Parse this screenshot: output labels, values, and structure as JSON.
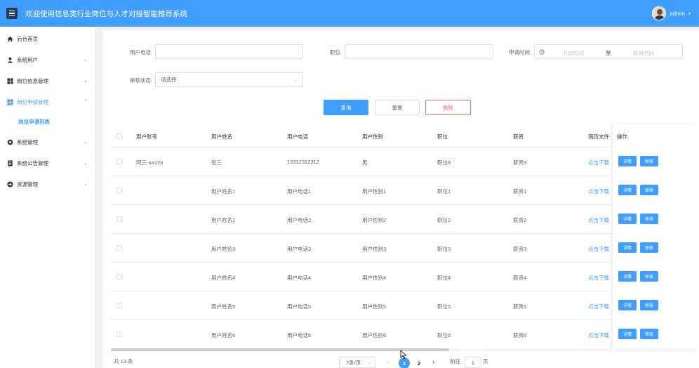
{
  "header": {
    "title": "欢迎使用信息类行业岗位与人才对接智能推荐系统",
    "username": "admin"
  },
  "sidebar": {
    "items": [
      {
        "label": "后台首页",
        "icon": "home-icon",
        "expandable": false
      },
      {
        "label": "系统用户",
        "icon": "user-icon",
        "expandable": true
      },
      {
        "label": "岗位信息管理",
        "icon": "grid-icon",
        "expandable": true
      },
      {
        "label": "岗位申请管理",
        "icon": "grid-icon",
        "expandable": true,
        "active": true
      },
      {
        "label": "系统管理",
        "icon": "gear-icon",
        "expandable": true
      },
      {
        "label": "系统公告管理",
        "icon": "document-icon",
        "expandable": true
      },
      {
        "label": "资源管理",
        "icon": "plus-circle-icon",
        "expandable": true
      }
    ],
    "sub_item": "岗位申请列表"
  },
  "filters": {
    "phone_label": "用户电话",
    "phone_value": "",
    "position_label": "职位",
    "position_value": "",
    "apply_time_label": "申请时间",
    "start_placeholder": "开始时间",
    "range_sep": "至",
    "end_placeholder": "结束时间",
    "audit_label": "审核状态",
    "audit_value": "请选择"
  },
  "actions": {
    "query": "查询",
    "reset": "重置",
    "delete": "删除"
  },
  "table": {
    "headers": [
      "用户账号",
      "用户姓名",
      "用户电话",
      "用户性别",
      "职位",
      "薪资",
      "简历文件",
      "操作"
    ],
    "rows": [
      {
        "account": "阿三-aa123",
        "name": "张三",
        "phone": "13312312312",
        "gender": "男",
        "position": "职位9",
        "salary": "薪资9",
        "resume": "点击下载"
      },
      {
        "account": "",
        "name": "用户姓名1",
        "phone": "用户电话1",
        "gender": "用户性别1",
        "position": "职位1",
        "salary": "薪资1",
        "resume": "点击下载"
      },
      {
        "account": "",
        "name": "用户姓名2",
        "phone": "用户电话2",
        "gender": "用户性别2",
        "position": "职位2",
        "salary": "薪资2",
        "resume": "点击下载"
      },
      {
        "account": "",
        "name": "用户姓名3",
        "phone": "用户电话3",
        "gender": "用户性别3",
        "position": "职位3",
        "salary": "薪资3",
        "resume": "点击下载"
      },
      {
        "account": "",
        "name": "用户姓名4",
        "phone": "用户电话4",
        "gender": "用户性别4",
        "position": "职位4",
        "salary": "薪资4",
        "resume": "点击下载"
      },
      {
        "account": "",
        "name": "用户姓名5",
        "phone": "用户电话5",
        "gender": "用户性别5",
        "position": "职位5",
        "salary": "薪资5",
        "resume": "点击下载"
      },
      {
        "account": "",
        "name": "用户姓名6",
        "phone": "用户电话6",
        "gender": "用户性别6",
        "position": "职位6",
        "salary": "薪资6",
        "resume": "点击下载"
      }
    ],
    "op_detail": "详情",
    "op_audit": "审核"
  },
  "pagination": {
    "total": "共 13 条",
    "page_size": "7条/页",
    "pages": [
      "1",
      "2"
    ],
    "current_page": "1",
    "goto_label": "前往",
    "goto_value": "1",
    "page_unit": "页"
  },
  "colors": {
    "primary": "#409eff",
    "danger": "#f56c6c"
  }
}
